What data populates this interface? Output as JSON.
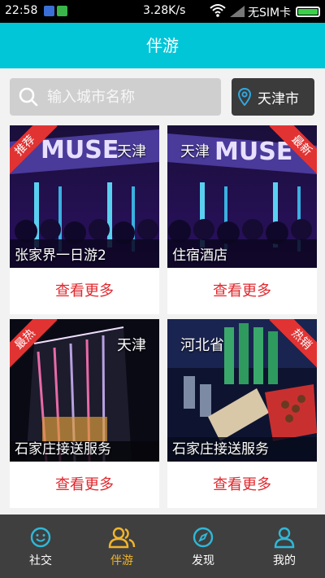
{
  "status_bar": {
    "time": "22:58",
    "speed": "3.28K/s",
    "sim": "无SIM卡",
    "icons": [
      "photo-notification-icon",
      "wechat-notification-icon",
      "wifi-icon",
      "signal-icon",
      "battery-icon"
    ],
    "battery_color": "#3ad04a"
  },
  "header": {
    "title": "伴游",
    "color": "#00c6d8"
  },
  "search": {
    "placeholder": "输入城市名称",
    "city_button": "天津市"
  },
  "cards": [
    {
      "ribbon": "推荐",
      "city": "天津",
      "title": "张家界一日游2",
      "more": "查看更多"
    },
    {
      "ribbon": "最新",
      "city": "天津",
      "title": "住宿酒店",
      "more": "查看更多"
    },
    {
      "ribbon": "最热",
      "city": "天津",
      "title": "石家庄接送服务",
      "more": "查看更多"
    },
    {
      "ribbon": "热销",
      "city": "河北省",
      "title": "石家庄接送服务",
      "more": "查看更多"
    }
  ],
  "tabs": [
    {
      "label": "社交",
      "icon": "smile-icon",
      "active": false
    },
    {
      "label": "伴游",
      "icon": "people-icon",
      "active": true
    },
    {
      "label": "发现",
      "icon": "compass-icon",
      "active": false
    },
    {
      "label": "我的",
      "icon": "person-icon",
      "active": false
    }
  ],
  "colors": {
    "accent": "#00c6d8",
    "active_tab": "#f2b52a",
    "more_text": "#e0282e",
    "ribbon": "#e23333",
    "tabbar": "#3f3f3f"
  }
}
